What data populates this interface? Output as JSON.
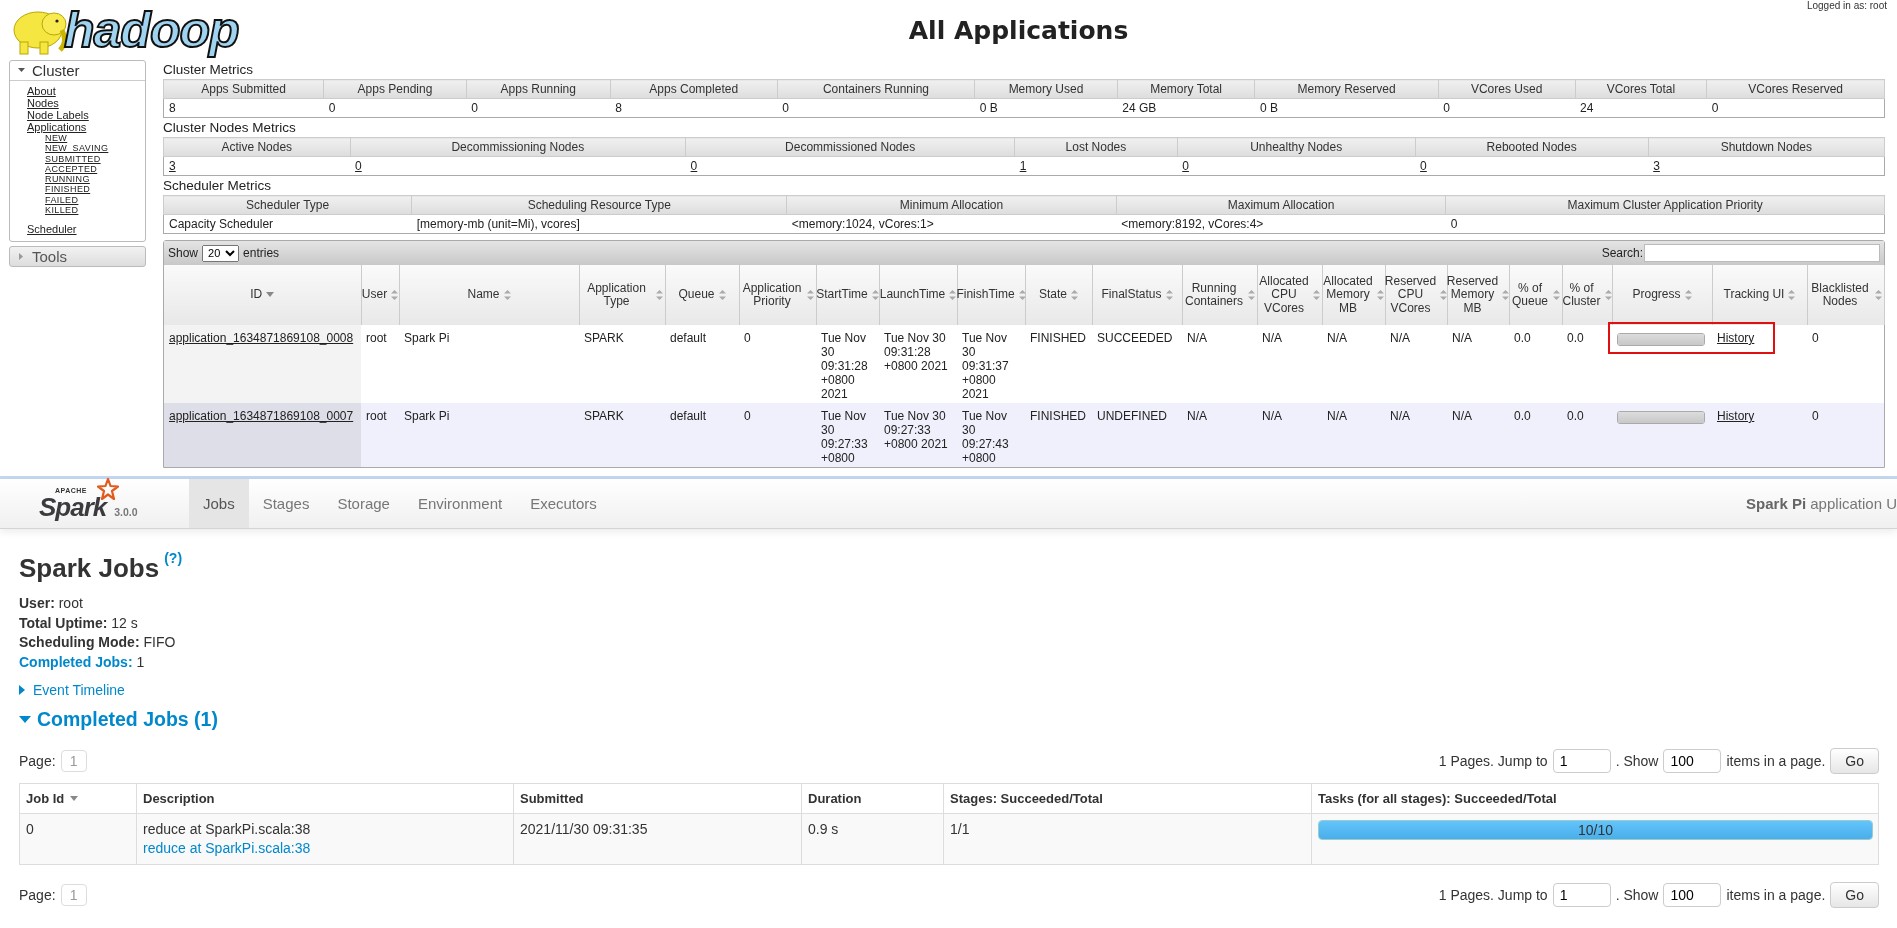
{
  "hadoop": {
    "logo_text": "hadoop",
    "title": "All Applications",
    "logged_in": "Logged in as: root",
    "sidebar": [
      {
        "title": "Cluster",
        "expanded": true,
        "items": [
          {
            "label": "About"
          },
          {
            "label": "Nodes"
          },
          {
            "label": "Node Labels"
          },
          {
            "label": "Applications",
            "children": [
              {
                "label": "NEW"
              },
              {
                "label": "NEW_SAVING"
              },
              {
                "label": "SUBMITTED"
              },
              {
                "label": "ACCEPTED"
              },
              {
                "label": "RUNNING"
              },
              {
                "label": "FINISHED"
              },
              {
                "label": "FAILED"
              },
              {
                "label": "KILLED"
              }
            ]
          },
          {
            "label": "Scheduler"
          }
        ]
      },
      {
        "title": "Tools",
        "expanded": false
      }
    ],
    "metrics": [
      {
        "title": "Cluster Metrics",
        "linked": false,
        "columns": [
          "Apps Submitted",
          "Apps Pending",
          "Apps Running",
          "Apps Completed",
          "Containers Running",
          "Memory Used",
          "Memory Total",
          "Memory Reserved",
          "VCores Used",
          "VCores Total",
          "VCores Reserved"
        ],
        "values": [
          "8",
          "0",
          "0",
          "8",
          "0",
          "0 B",
          "24 GB",
          "0 B",
          "0",
          "24",
          "0"
        ]
      },
      {
        "title": "Cluster Nodes Metrics",
        "linked": true,
        "columns": [
          "Active Nodes",
          "Decommissioning Nodes",
          "Decommissioned Nodes",
          "Lost Nodes",
          "Unhealthy Nodes",
          "Rebooted Nodes",
          "Shutdown Nodes"
        ],
        "values": [
          "3",
          "0",
          "0",
          "1",
          "0",
          "0",
          "3"
        ]
      },
      {
        "title": "Scheduler Metrics",
        "linked": false,
        "columns": [
          "Scheduler Type",
          "Scheduling Resource Type",
          "Minimum Allocation",
          "Maximum Allocation",
          "Maximum Cluster Application Priority"
        ],
        "values": [
          "Capacity Scheduler",
          "[memory-mb (unit=Mi), vcores]",
          "<memory:1024, vCores:1>",
          "<memory:8192, vCores:4>",
          "0"
        ]
      }
    ],
    "apps_table": {
      "show_label": "Show",
      "page_size": "20",
      "entries_label": "entries",
      "search_label": "Search:",
      "columns": [
        {
          "label": "ID",
          "sorted": true
        },
        {
          "label": "User",
          "sorted": false
        },
        {
          "label": "Name",
          "sorted": false
        },
        {
          "label": "Application Type",
          "sorted": false
        },
        {
          "label": "Queue",
          "sorted": false
        },
        {
          "label": "Application Priority",
          "sorted": false
        },
        {
          "label": "StartTime",
          "sorted": false
        },
        {
          "label": "LaunchTime",
          "sorted": false
        },
        {
          "label": "FinishTime",
          "sorted": false
        },
        {
          "label": "State",
          "sorted": false
        },
        {
          "label": "FinalStatus",
          "sorted": false
        },
        {
          "label": "Running Containers",
          "sorted": false
        },
        {
          "label": "Allocated CPU VCores",
          "sorted": false
        },
        {
          "label": "Allocated Memory MB",
          "sorted": false
        },
        {
          "label": "Reserved CPU VCores",
          "sorted": false
        },
        {
          "label": "Reserved Memory MB",
          "sorted": false
        },
        {
          "label": "% of Queue",
          "sorted": false
        },
        {
          "label": "% of Cluster",
          "sorted": false
        },
        {
          "label": "Progress",
          "sorted": false
        },
        {
          "label": "Tracking UI",
          "sorted": false
        },
        {
          "label": "Blacklisted Nodes",
          "sorted": false
        }
      ],
      "rows": [
        {
          "highlighted": true,
          "cells": [
            "application_1634871869108_0008",
            "root",
            "Spark Pi",
            "SPARK",
            "default",
            "0",
            "Tue Nov 30 09:31:28 +0800 2021",
            "Tue Nov 30 09:31:28 +0800 2021",
            "Tue Nov 30 09:31:37 +0800 2021",
            "FINISHED",
            "SUCCEEDED",
            "N/A",
            "N/A",
            "N/A",
            "N/A",
            "N/A",
            "0.0",
            "0.0"
          ],
          "progress": {
            "level": 1
          },
          "tracking_ui": "History",
          "blacklisted_nodes": "0"
        },
        {
          "highlighted": false,
          "cells": [
            "application_1634871869108_0007",
            "root",
            "Spark Pi",
            "SPARK",
            "default",
            "0",
            "Tue Nov 30 09:27:33 +0800",
            "Tue Nov 30 09:27:33 +0800 2021",
            "Tue Nov 30 09:27:43 +0800",
            "FINISHED",
            "UNDEFINED",
            "N/A",
            "N/A",
            "N/A",
            "N/A",
            "N/A",
            "0.0",
            "0.0"
          ],
          "progress": {
            "level": 1
          },
          "tracking_ui": "History",
          "blacklisted_nodes": "0"
        }
      ]
    }
  },
  "spark": {
    "logo_apache": "APACHE",
    "logo_text": "Spark",
    "version": "3.0.0",
    "tabs": [
      {
        "label": "Jobs",
        "selected": true
      },
      {
        "label": "Stages",
        "selected": false
      },
      {
        "label": "Storage",
        "selected": false
      },
      {
        "label": "Environment",
        "selected": false
      },
      {
        "label": "Executors",
        "selected": false
      }
    ],
    "app_title": "**Spark Pi** application U",
    "title": "Spark Jobs",
    "help": "(?)",
    "info": [
      {
        "kind": "plain",
        "label": "User:",
        "value": "root"
      },
      {
        "kind": "plain",
        "label": "Total Uptime:",
        "value": "12 s"
      },
      {
        "kind": "plain",
        "label": "Scheduling Mode:",
        "value": "FIFO"
      },
      {
        "kind": "link",
        "label": "Completed Jobs:",
        "value": "1"
      }
    ],
    "event_timeline": {
      "label": "Event Timeline",
      "expanded": false
    },
    "completed_jobs": {
      "label": "Completed Jobs (1)",
      "expanded": true
    },
    "pagination": [
      {
        "page_label": "Page:",
        "page": "1",
        "pages_text": "1 Pages. Jump to",
        "jump_value": "1",
        "show_text": ". Show",
        "show_value": "100",
        "items_text": "items in a page.",
        "go": "Go"
      },
      {
        "page_label": "Page:",
        "page": "1",
        "pages_text": "1 Pages. Jump to",
        "jump_value": "1",
        "show_text": ". Show",
        "show_value": "100",
        "items_text": "items in a page.",
        "go": "Go"
      }
    ],
    "jobs_table": {
      "columns": [
        {
          "label": "Job Id",
          "sorted": true
        },
        {
          "label": "Description",
          "sorted": false
        },
        {
          "label": "Submitted",
          "sorted": false
        },
        {
          "label": "Duration",
          "sorted": false
        },
        {
          "label": "Stages: Succeeded/Total",
          "sorted": false
        },
        {
          "label": "Tasks (for all stages): Succeeded/Total",
          "sorted": false
        }
      ],
      "rows": [
        {
          "job_id": "0",
          "description": "reduce at SparkPi.scala:38",
          "description_link": "reduce at SparkPi.scala:38",
          "submitted": "2021/11/30 09:31:35",
          "duration": "0.9 s",
          "stages": "1/1",
          "tasks": {
            "label": "10/10",
            "level": 1
          }
        }
      ]
    }
  }
}
